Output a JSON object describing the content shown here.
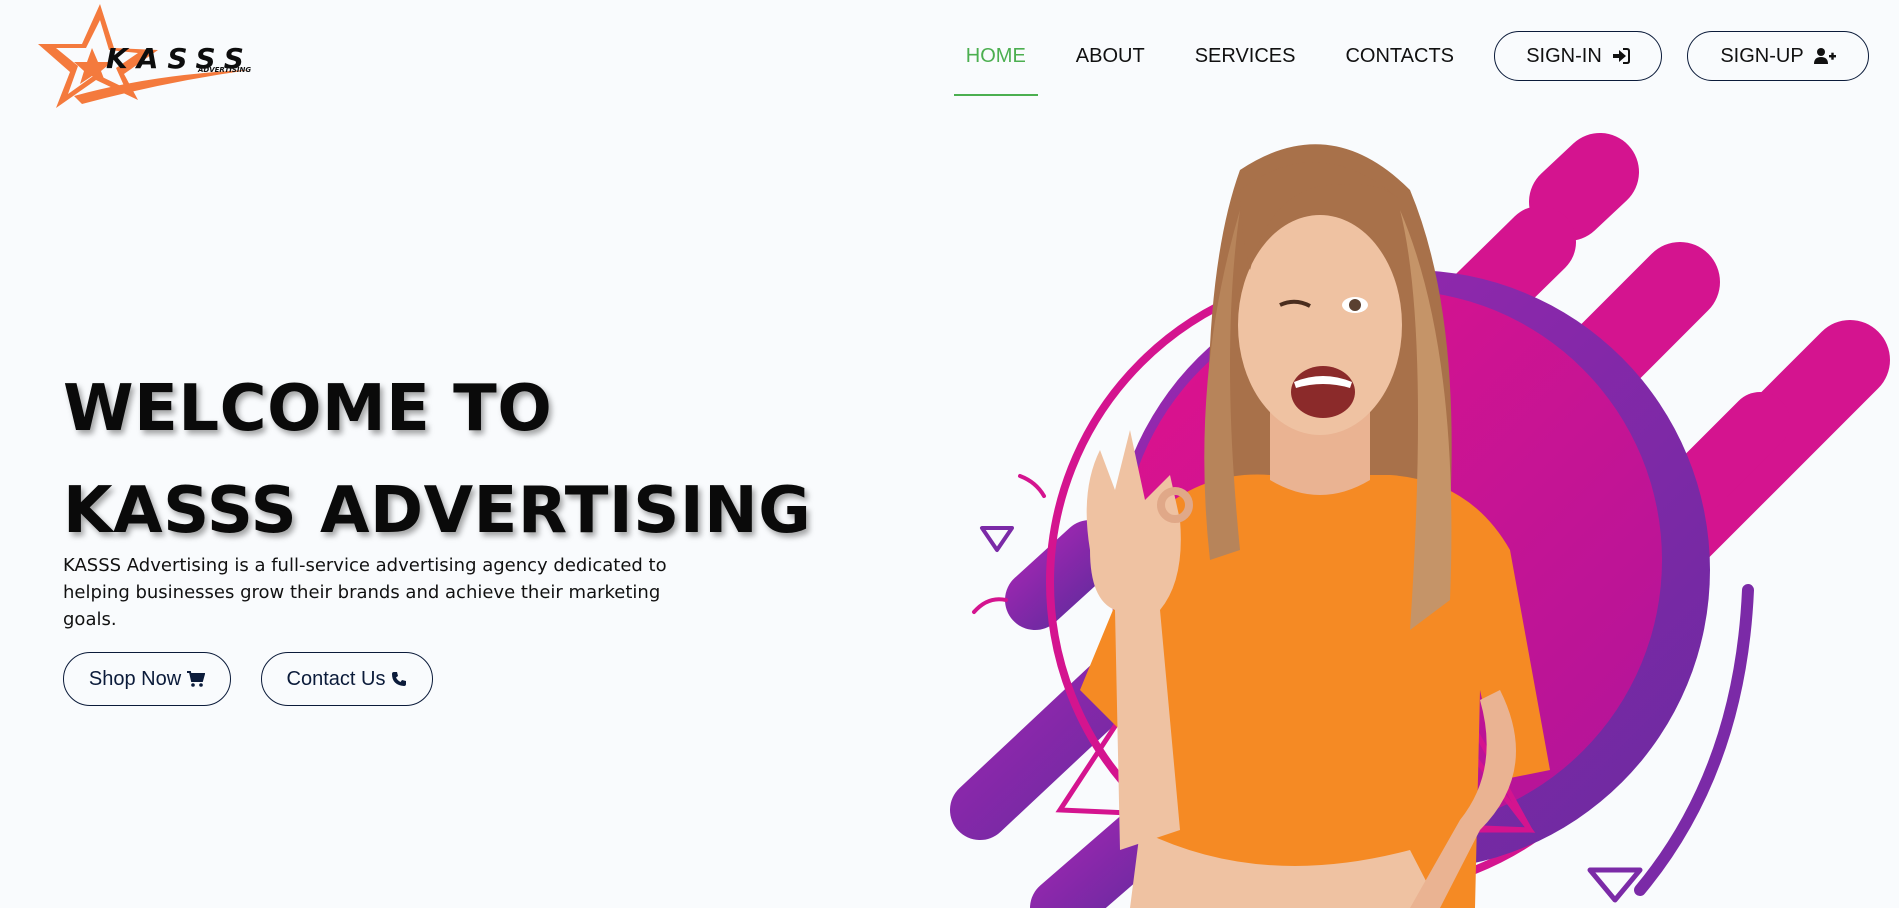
{
  "brand": {
    "name": "KASSS",
    "tagline": "ADVERTISING"
  },
  "nav": {
    "items": [
      {
        "label": "HOME",
        "active": true
      },
      {
        "label": "ABOUT",
        "active": false
      },
      {
        "label": "SERVICES",
        "active": false
      },
      {
        "label": "CONTACTS",
        "active": false
      }
    ],
    "signin_label": "SIGN-IN",
    "signup_label": "SIGN-UP"
  },
  "hero": {
    "title_line1": "WELCOME TO",
    "title_line2": "KASSS ADVERTISING",
    "description": "KASSS Advertising is a full-service advertising agency dedicated to helping businesses grow their brands and achieve their marketing goals.",
    "shop_label": "Shop Now",
    "contact_label": "Contact Us"
  },
  "icons": {
    "signin": "sign-in-icon",
    "signup": "user-plus-icon",
    "shop": "shopping-cart-icon",
    "contact": "phone-icon"
  },
  "colors": {
    "accent_active": "#4caf50",
    "button_border": "#0b1b3a",
    "logo_orange": "#f47a3d",
    "art_magenta": "#d4148f",
    "art_purple": "#7b2aa7",
    "shirt_orange": "#f58a24"
  }
}
